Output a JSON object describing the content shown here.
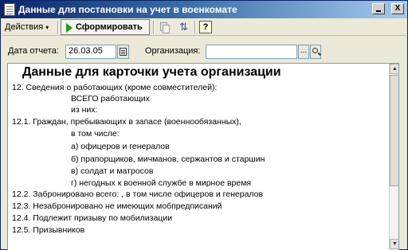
{
  "window": {
    "title": "Данные для постановки на учет в военкомате",
    "minimize_glyph": "",
    "close_glyph": "X"
  },
  "toolbar": {
    "actions_label": "Действия",
    "actions_arrow": "▾",
    "run_label": "Сформировать",
    "help_label": "?"
  },
  "params": {
    "date_label": "Дата отчета:",
    "date_value": "26.03.05",
    "org_label": "Организация:",
    "org_value": "",
    "dots_label": "..."
  },
  "report": {
    "title": "Данные для карточки учета организации",
    "lines": [
      "12. Сведения о работающих (кроме совместителей):",
      "ВСЕГО работающих",
      "из них:",
      "12.1. Граждан, пребывающих в запасе (военнообязанных),",
      "в том числе:",
      "а) офицеров и генералов",
      "б) прапорщиков, мичманов, сержантов и старшин",
      "в) солдат и матросов",
      "г) негодных к военной службе в мирное время",
      "12.2. Забронировано всего:  , в том числе офицеров и генералов",
      "12.3. Незабронировано не имеющих мобпредписаний",
      "12.4. Подлежит призыву по мобилизации",
      "12.5. Призывников"
    ]
  }
}
